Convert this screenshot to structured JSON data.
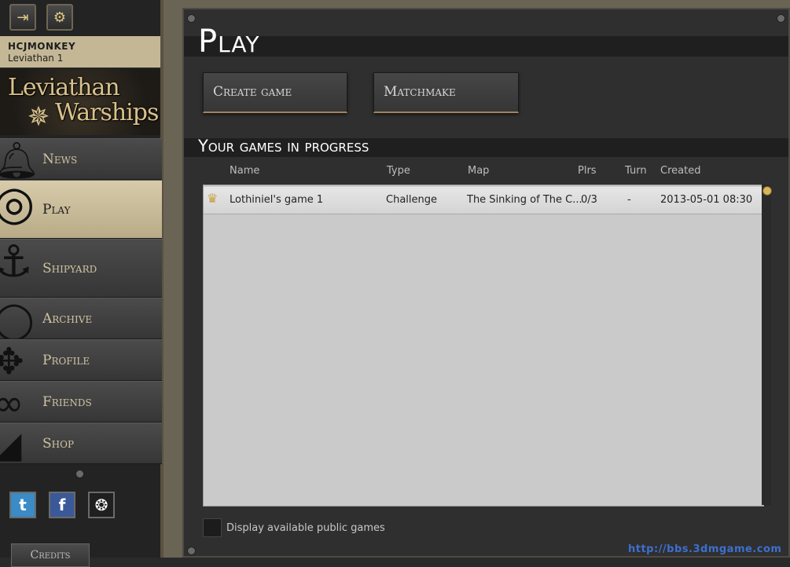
{
  "sidebar": {
    "top_icons": [
      "exit-icon",
      "gear-icon"
    ],
    "user": {
      "name": "HCJMONKEY",
      "ship": "Leviathan 1"
    },
    "logo": {
      "line1": "Leviathan",
      "line2": "Warships"
    },
    "items": [
      {
        "label": "News",
        "icon": "bell-icon"
      },
      {
        "label": "Play",
        "icon": "compass-icon"
      },
      {
        "label": "Shipyard",
        "icon": "anchor-icon"
      },
      {
        "label": "Archive",
        "icon": "lifebuoy-icon"
      },
      {
        "label": "Profile",
        "icon": "fish-skeleton-icon"
      },
      {
        "label": "Friends",
        "icon": "rope-knot-icon"
      },
      {
        "label": "Shop",
        "icon": "bag-icon"
      }
    ],
    "social": [
      "twitter-icon",
      "facebook-icon",
      "paradox-icon"
    ],
    "credits_label": "Credits"
  },
  "main": {
    "title": "Play",
    "buttons": {
      "create": "Create game",
      "matchmake": "Matchmake"
    },
    "section_title": "Your games in progress",
    "columns": [
      "Name",
      "Type",
      "Map",
      "Plrs",
      "Turn",
      "Created"
    ],
    "games": [
      {
        "name": "Lothiniel's game 1",
        "type": "Challenge",
        "map": "The Sinking of The C...",
        "players": "0/3",
        "turn": "-",
        "created": "2013-05-01 08:30"
      }
    ],
    "public_games_label": "Display available public games"
  },
  "watermark": "http://bbs.3dmgame.com"
}
